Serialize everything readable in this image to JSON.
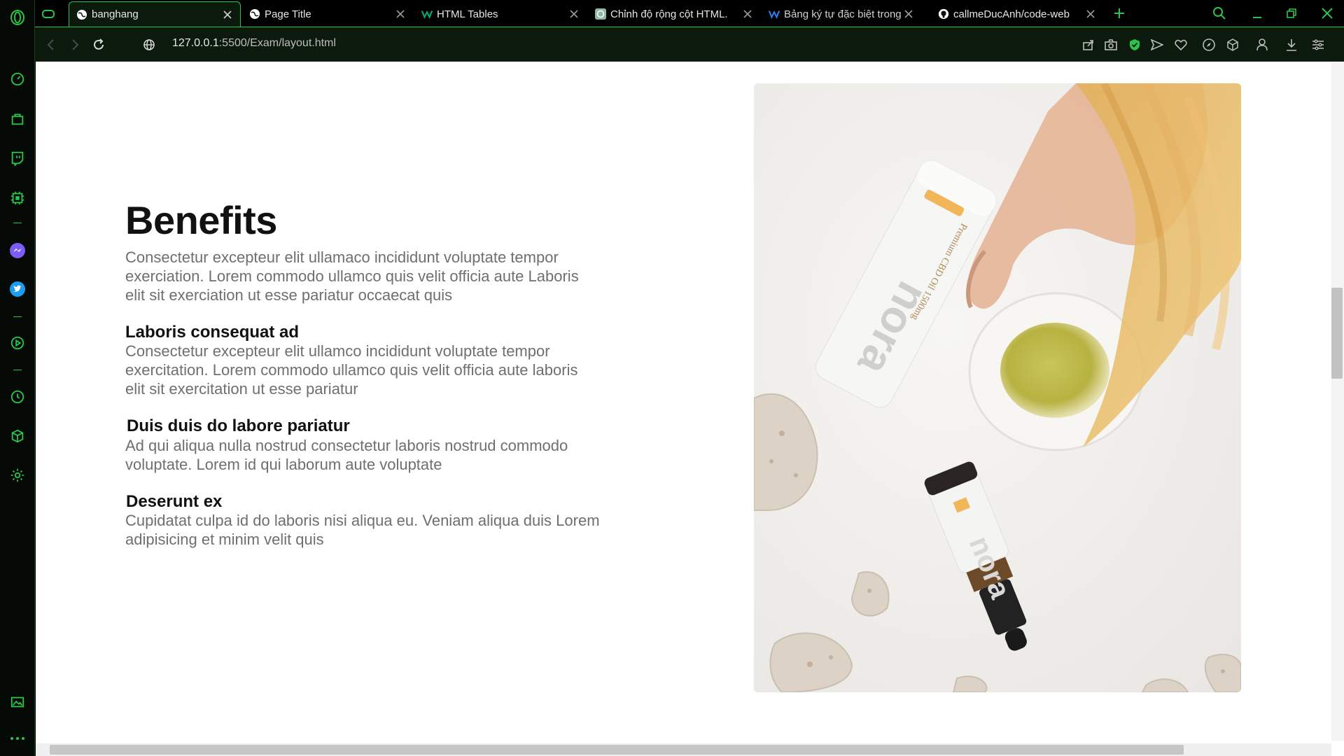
{
  "tabs": [
    {
      "title": "banghang",
      "active": true,
      "favicon": "globe-icon"
    },
    {
      "title": "Page Title",
      "active": false,
      "favicon": "globe-icon"
    },
    {
      "title": "HTML Tables",
      "active": false,
      "favicon": "w3schools-icon"
    },
    {
      "title": "Chỉnh độ rộng cột HTML.",
      "active": false,
      "favicon": "chatgpt-icon"
    },
    {
      "title": "Bảng ký tự đặc biệt trong H",
      "active": false,
      "favicon": "w-logo-icon"
    },
    {
      "title": "callmeDucAnh/code-web",
      "active": false,
      "favicon": "github-icon"
    }
  ],
  "address": {
    "host": "127.0.0.1",
    "rest": ":5500/Exam/layout.html"
  },
  "page": {
    "heading": "Benefits",
    "lead": "Consectetur excepteur elit ullamaco incididunt voluptate tempor exerciation. Lorem commodo ullamco quis velit officia aute Laboris elit sit exerciation ut esse pariatur occaecat quis",
    "items": [
      {
        "title": "Laboris consequat ad",
        "text": "Consectetur excepteur elit ullamco incididunt voluptate tempor exercitation. Lorem commodo ullamco quis velit officia aute laboris elit sit exercitation ut esse pariatur"
      },
      {
        "title": "Duis duis do labore pariatur",
        "text": "Ad qui aliqua nulla nostrud consectetur laboris nostrud commodo voluptate. Lorem id qui laborum aute voluptate"
      },
      {
        "title": "Deserunt ex",
        "text": "Cupidatat culpa id do laboris nisi aliqua eu. Veniam aliqua duis Lorem adipisicing et minim velit quis"
      }
    ],
    "photo_labels": {
      "brand": "nora",
      "bottle_text": "Premium CBD Oil 1500mg"
    }
  },
  "colors": {
    "accent": "#2cc34a",
    "chrome_bg": "#0c1a0e",
    "body_text": "#6f6f6f",
    "heading_text": "#111111"
  }
}
